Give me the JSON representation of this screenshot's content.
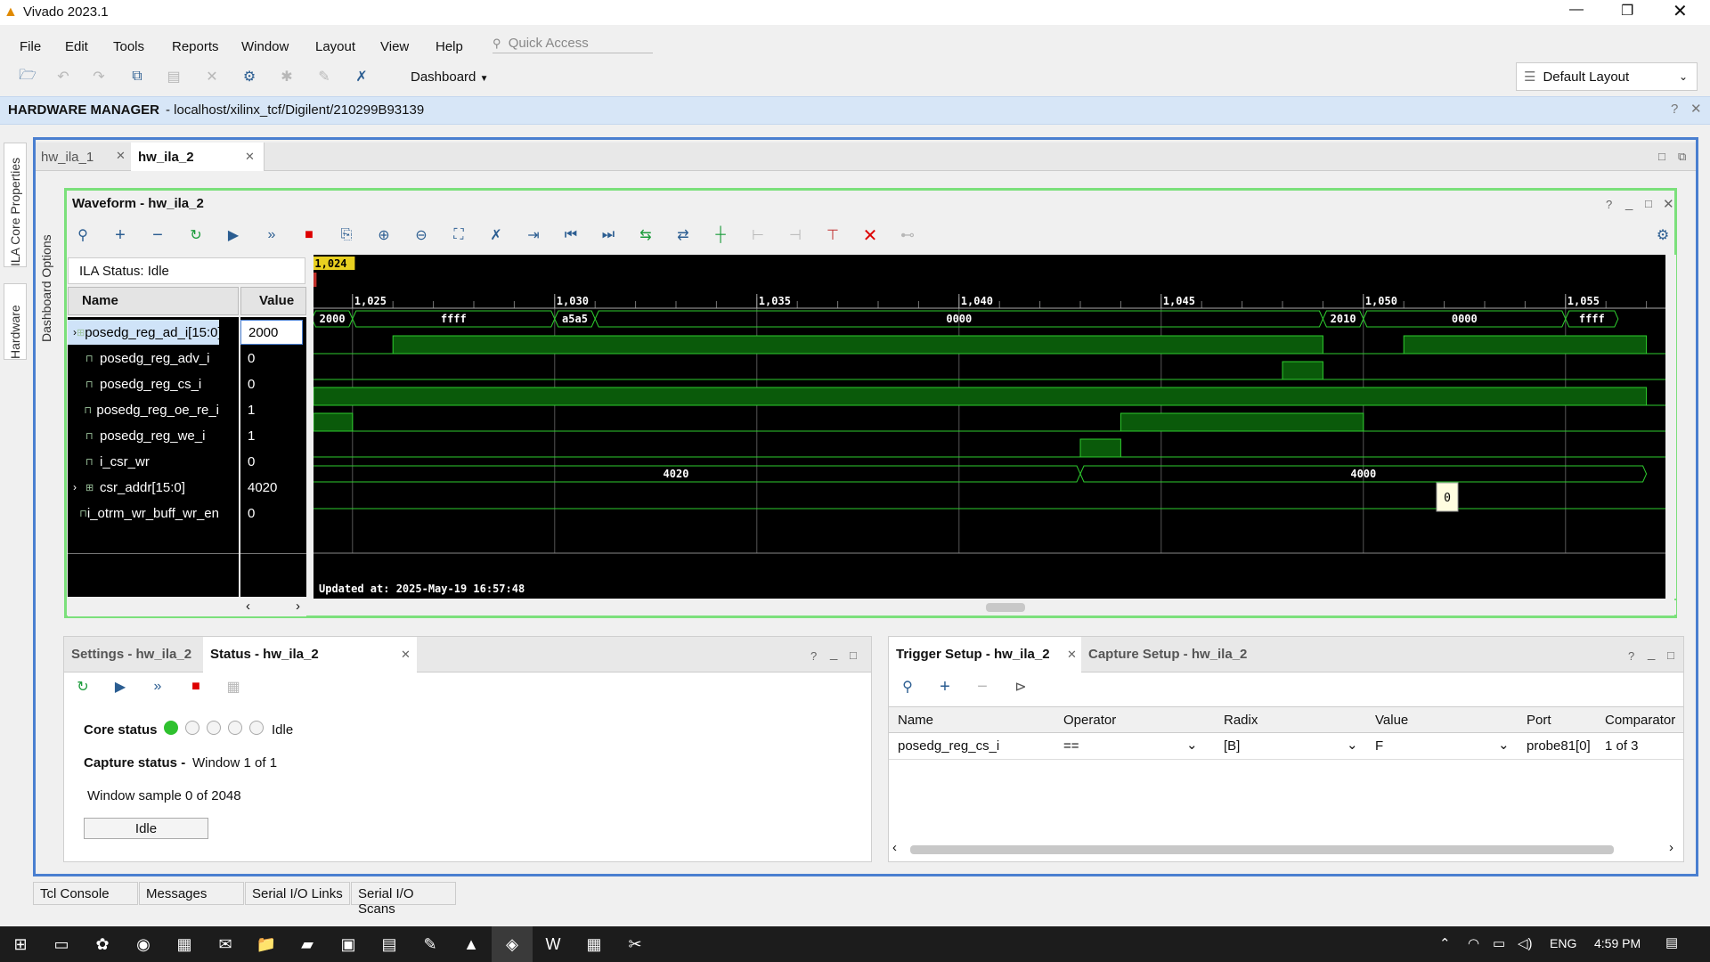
{
  "app": {
    "title": "Vivado 2023.1"
  },
  "menu": [
    "File",
    "Edit",
    "Tools",
    "Reports",
    "Window",
    "Layout",
    "View",
    "Help"
  ],
  "quick_access": {
    "placeholder": "Quick Access"
  },
  "toolbar": {
    "dashboard_label": "Dashboard",
    "layout_label": "Default Layout"
  },
  "hardware_manager": {
    "title": "HARDWARE MANAGER",
    "path": "- localhost/xilinx_tcf/Digilent/210299B93139"
  },
  "side_tabs": {
    "left1": "ILA Core Properties",
    "left2": "Hardware",
    "left3": "Dashboard Options"
  },
  "doc_tabs": [
    {
      "label": "hw_ila_1"
    },
    {
      "label": "hw_ila_2"
    }
  ],
  "waveform": {
    "title": "Waveform - hw_ila_2",
    "ila_status": "ILA Status: Idle",
    "col_name": "Name",
    "col_value": "Value",
    "cursor": "1,024",
    "updated": "Updated at: 2025-May-19 16:57:48",
    "tooltip": "0",
    "ticks": [
      "1,025",
      "1,030",
      "1,035",
      "1,040",
      "1,045",
      "1,050",
      "1,055"
    ],
    "signals": [
      {
        "name": "posedg_reg_ad_i[15:0]",
        "value": "2000",
        "bus": true
      },
      {
        "name": "posedg_reg_adv_i",
        "value": "0",
        "bus": false
      },
      {
        "name": "posedg_reg_cs_i",
        "value": "0",
        "bus": false
      },
      {
        "name": "posedg_reg_oe_re_i",
        "value": "1",
        "bus": false
      },
      {
        "name": "posedg_reg_we_i",
        "value": "1",
        "bus": false
      },
      {
        "name": "i_csr_wr",
        "value": "0",
        "bus": false
      },
      {
        "name": "csr_addr[15:0]",
        "value": "4020",
        "bus": true
      },
      {
        "name": "i_otrm_wr_buff_wr_en",
        "value": "0",
        "bus": false
      }
    ],
    "bus_labels": {
      "ad": [
        "ffff",
        "2000",
        "ffff",
        "a5a5",
        "0000",
        "2010",
        "0000",
        "ffff"
      ],
      "addr": [
        "4020",
        "4000"
      ]
    }
  },
  "settings_tab": "Settings - hw_ila_2",
  "status_tab": "Status - hw_ila_2",
  "status": {
    "core_label": "Core status",
    "core_value": "Idle",
    "capture_label": "Capture status -",
    "capture_value": "Window 1 of 1",
    "window_sample": "Window sample 0 of 2048",
    "button": "Idle"
  },
  "trigger_tab": "Trigger Setup - hw_ila_2",
  "capture_tab": "Capture Setup - hw_ila_2",
  "trigger": {
    "headers": [
      "Name",
      "Operator",
      "Radix",
      "Value",
      "Port",
      "Comparator"
    ],
    "row": {
      "name": "posedg_reg_cs_i",
      "operator": "==",
      "radix": "[B]",
      "value": "F",
      "port": "probe81[0]",
      "comparator": "1 of 3"
    }
  },
  "bottom_tabs": [
    "Tcl Console",
    "Messages",
    "Serial I/O Links",
    "Serial I/O Scans"
  ],
  "system": {
    "lang": "ENG",
    "time": "4:59 PM"
  }
}
